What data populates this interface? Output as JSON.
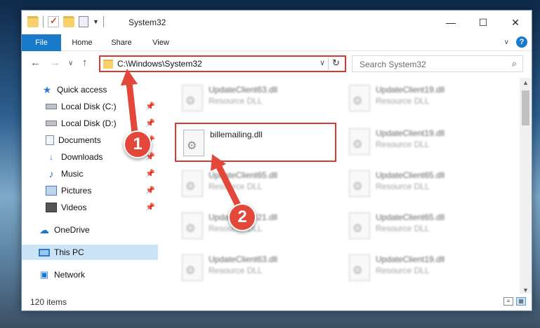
{
  "window": {
    "title": "System32"
  },
  "window_controls": {
    "minimize": "—",
    "maximize": "☐",
    "close": "✕"
  },
  "ribbon": {
    "tabs": [
      {
        "label": "File"
      },
      {
        "label": "Home"
      },
      {
        "label": "Share"
      },
      {
        "label": "View"
      }
    ],
    "collapse": "∨",
    "help": "?"
  },
  "nav": {
    "back": "←",
    "forward": "→",
    "recent": "∨",
    "up": "↑",
    "address": "C:\\Windows\\System32",
    "address_dropdown": "∨",
    "refresh": "↻",
    "search_placeholder": "Search System32",
    "search_icon": "⌕"
  },
  "sidebar": {
    "items": [
      {
        "label": "Quick access",
        "icon": "star-icon",
        "pinned": false
      },
      {
        "label": "Local Disk (C:)",
        "icon": "disk-icon",
        "pinned": true
      },
      {
        "label": "Local Disk (D:)",
        "icon": "disk-icon",
        "pinned": true
      },
      {
        "label": "Documents",
        "icon": "document-icon",
        "pinned": true
      },
      {
        "label": "Downloads",
        "icon": "download-icon",
        "pinned": true
      },
      {
        "label": "Music",
        "icon": "music-icon",
        "pinned": true
      },
      {
        "label": "Pictures",
        "icon": "picture-icon",
        "pinned": true
      },
      {
        "label": "Videos",
        "icon": "video-icon",
        "pinned": true
      },
      {
        "label": "OneDrive",
        "icon": "cloud-icon",
        "pinned": false
      },
      {
        "label": "This PC",
        "icon": "computer-icon",
        "pinned": false,
        "selected": true
      },
      {
        "label": "Network",
        "icon": "network-icon",
        "pinned": false
      }
    ],
    "pin_glyph": "📌"
  },
  "files": [
    {
      "name": "UpdateClient63.dll",
      "type": "Resource DLL"
    },
    {
      "name": "UpdateClient19.dll",
      "type": "Resource DLL"
    },
    {
      "name": "billemailing.dll",
      "type": ""
    },
    {
      "name": "UpdateClient19.dll",
      "type": "Resource DLL"
    },
    {
      "name": "UpdateClient65.dll",
      "type": "Resource DLL"
    },
    {
      "name": "UpdateClient65.dll",
      "type": "Resource DLL"
    },
    {
      "name": "UpdateClient21.dll",
      "type": "Resource DLL"
    },
    {
      "name": "UpdateClient65.dll",
      "type": "Resource DLL"
    },
    {
      "name": "UpdateClient63.dll",
      "type": "Resource DLL"
    },
    {
      "name": "UpdateClient19.dll",
      "type": "Resource DLL"
    }
  ],
  "status": {
    "item_count": "120 items"
  },
  "annotations": {
    "badge1": "1",
    "badge2": "2",
    "color": "#e2473a"
  },
  "colors": {
    "accent": "#1979ca",
    "highlight_border": "#d6392d",
    "selection": "#cce4f7"
  }
}
